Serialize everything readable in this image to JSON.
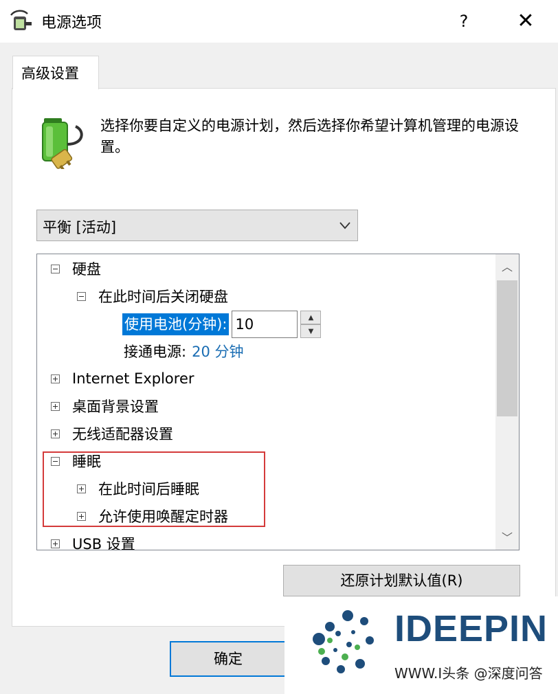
{
  "window": {
    "title": "电源选项",
    "help_label": "?",
    "close_label": "✕"
  },
  "tab": {
    "label": "高级设置"
  },
  "description": "选择你要自定义的电源计划，然后选择你希望计算机管理的电源设置。",
  "plan_select": {
    "value": "平衡 [活动]"
  },
  "tree": {
    "hard_disk": {
      "label": "硬盘",
      "expanded": true
    },
    "turn_off_disk": {
      "label": "在此时间后关闭硬盘",
      "expanded": true
    },
    "on_battery": {
      "label": "使用电池(分钟):",
      "value": "10"
    },
    "plugged_in": {
      "label": "接通电源:",
      "value": "20 分钟"
    },
    "ie": {
      "label": "Internet Explorer"
    },
    "desktop_bg": {
      "label": "桌面背景设置"
    },
    "wireless": {
      "label": "无线适配器设置"
    },
    "sleep": {
      "label": "睡眠",
      "expanded": true
    },
    "sleep_after": {
      "label": "在此时间后睡眠"
    },
    "wake_timers": {
      "label": "允许使用唤醒定时器"
    },
    "usb": {
      "label": "USB 设置"
    }
  },
  "buttons": {
    "restore": "还原计划默认值(R)",
    "ok": "确定"
  },
  "watermark": {
    "brand": "IDEEPIN",
    "sub": "WWW.I头条 @深度问答"
  },
  "colors": {
    "selection": "#0078d7",
    "link_value": "#1a6db3",
    "highlight_border": "#d43a3a"
  }
}
